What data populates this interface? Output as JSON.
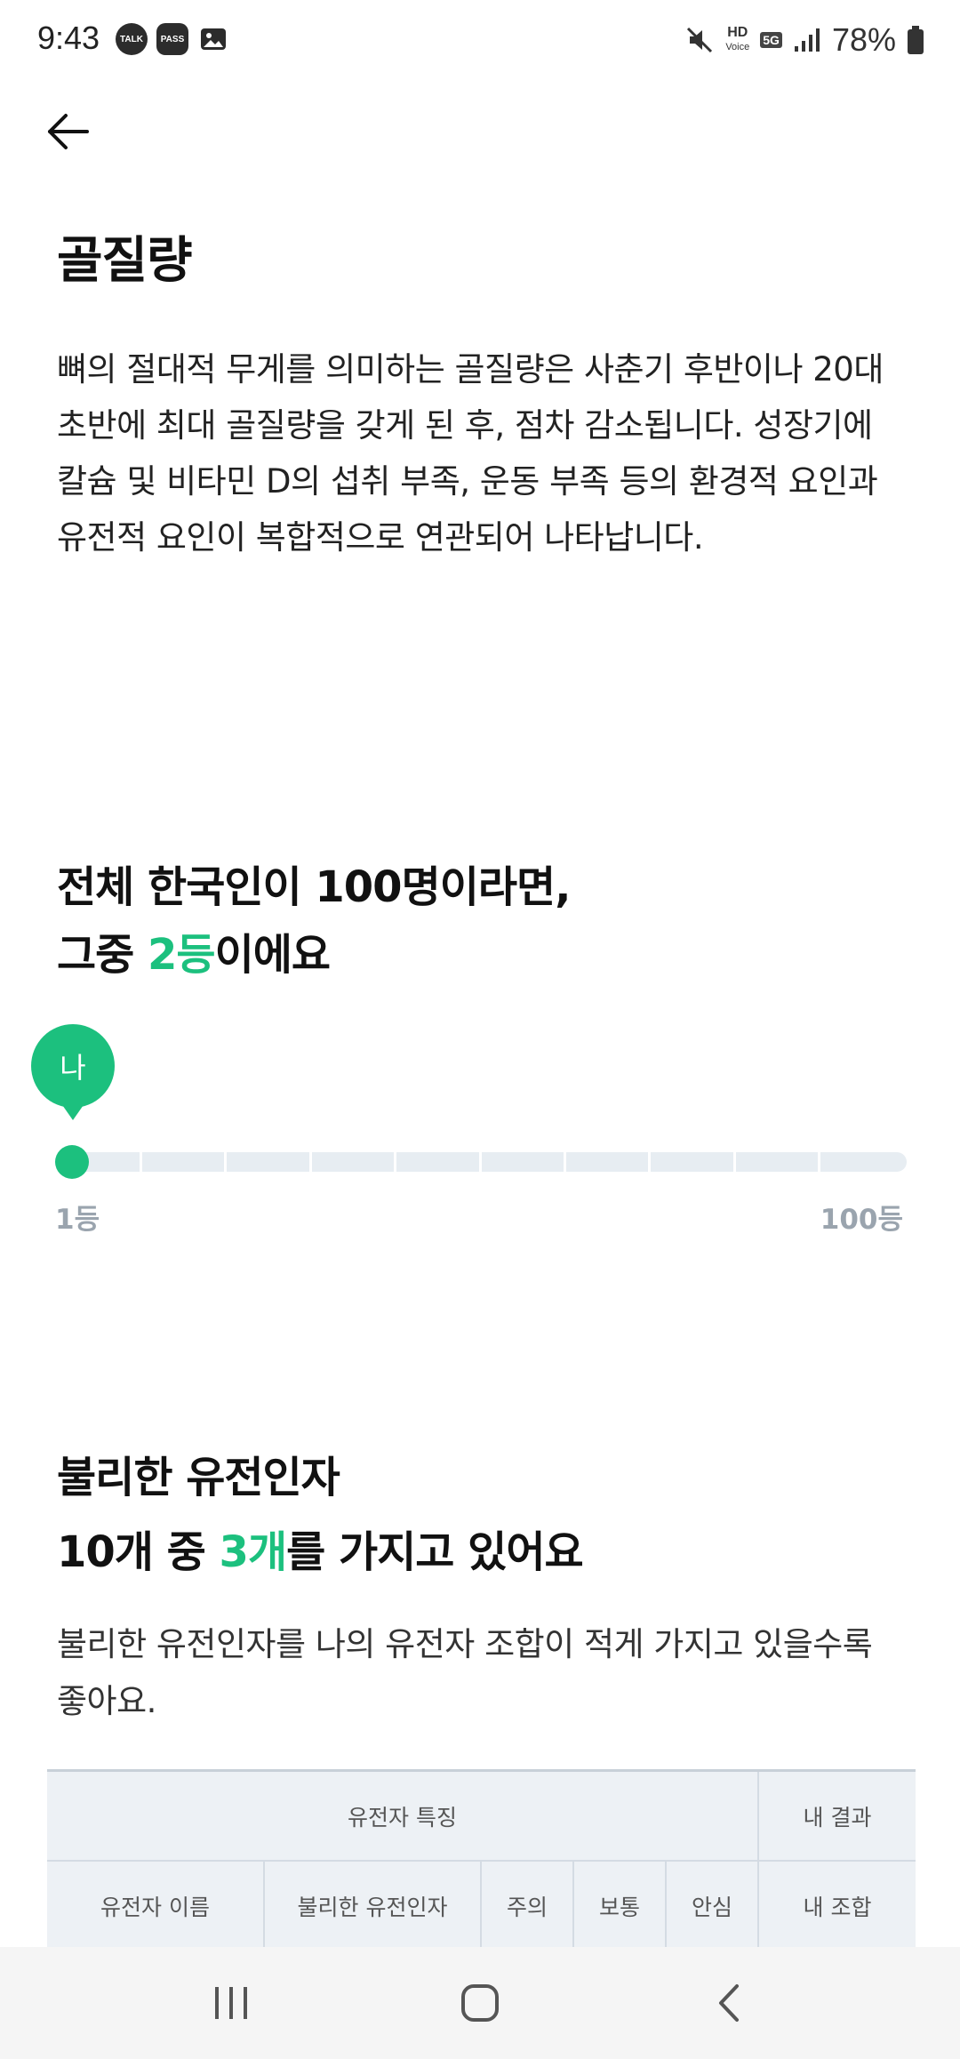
{
  "status_bar": {
    "time": "9:43",
    "notifications": [
      "TALK",
      "PASS"
    ],
    "hd_label": "HD",
    "voice_label": "Voice",
    "network": "5G",
    "battery": "78%"
  },
  "header": {
    "back_icon": "arrow-left-icon"
  },
  "title": "골질량",
  "description": "뼈의 절대적 무게를 의미하는 골질량은 사춘기 후반이나 20대 초반에 최대 골질량을 갖게 된 후, 점차 감소됩니다. 성장기에 칼슘 및 비타민 D의 섭취 부족, 운동 부족 등의 환경적 요인과 유전적 요인이 복합적으로 연관되어 나타납니다.",
  "rank_section": {
    "heading_line1": "전체 한국인이 100명이라면,",
    "heading_pre": "그중 ",
    "heading_rank": "2등",
    "heading_post": "이에요",
    "marker_label": "나",
    "min_label": "1등",
    "max_label": "100등",
    "my_rank": 2,
    "total": 100
  },
  "gene_section": {
    "heading_line1": "불리한 유전인자",
    "heading_pre": "10개 중 ",
    "heading_count": "3개",
    "heading_post": "를 가지고 있어요",
    "description": "불리한 유전인자를 나의 유전자 조합이 적게 가지고 있을수록 좋아요."
  },
  "table": {
    "group_header": "유전자 특징",
    "result_header": "내 결과",
    "columns": [
      "유전자 이름",
      "불리한 유전인자",
      "주의",
      "보통",
      "안심",
      "내 조합"
    ]
  },
  "colors": {
    "accent": "#1cc07e",
    "track": "#e7edf2",
    "muted_label": "#9aa4ae",
    "table_header_bg": "#edf1f5"
  },
  "nav": {
    "recents_icon": "recents-icon",
    "home_icon": "home-icon",
    "back_icon": "back-chevron-icon"
  }
}
